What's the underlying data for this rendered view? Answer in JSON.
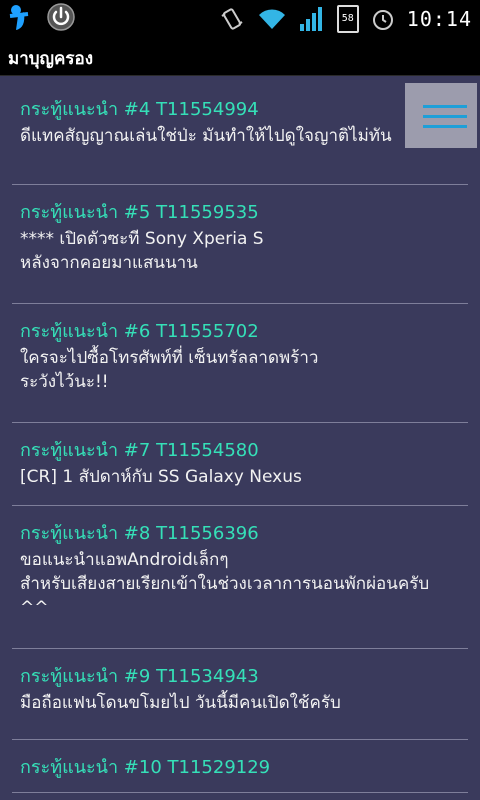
{
  "status_bar": {
    "battery_level": "58",
    "time": "10:14",
    "icons": [
      "carrier-logo-icon",
      "power-icon",
      "vibrate-icon",
      "wifi-icon",
      "signal-icon",
      "battery-icon",
      "alarm-icon"
    ]
  },
  "app_bar": {
    "title": "มาบุญครอง"
  },
  "menu_button": {
    "icon": "hamburger-menu-icon"
  },
  "colors": {
    "background": "#3a3a5c",
    "heading": "#35e0b8",
    "text": "#f2f2f2",
    "divider": "#7e7e9a",
    "menu_accent": "#1e9fd8"
  },
  "threads": [
    {
      "heading": "กระทู้แนะนำ #4 T11554994",
      "body": "ดีแทคสัญญาณเล่นใช่ป่ะ มันทำให้ไปดูใจญาติไม่ทัน"
    },
    {
      "heading": "กระทู้แนะนำ #5 T11559535",
      "body": "**** เปิดตัวซะที Sony Xperia S\nหลังจากคอยมาแสนนาน"
    },
    {
      "heading": "กระทู้แนะนำ #6 T11555702",
      "body": "ใครจะไปซื้อโทรศัพท์ที่ เซ็นทรัลลาดพร้าว\nระวังไว้นะ!!"
    },
    {
      "heading": "กระทู้แนะนำ #7 T11554580",
      "body": "[CR] 1 สัปดาห์กับ SS Galaxy Nexus"
    },
    {
      "heading": "กระทู้แนะนำ #8 T11556396",
      "body": "ขอแนะนำแอพAndroidเล็กๆ\nสำหรับเสียงสายเรียกเข้าในช่วงเวลาการนอนพักผ่อนครับ ^^"
    },
    {
      "heading": "กระทู้แนะนำ #9 T11534943",
      "body": "มือถือแฟนโดนขโมยไป วันนี้มีคนเปิดใช้ครับ"
    },
    {
      "heading": "กระทู้แนะนำ #10 T11529129",
      "body": ""
    }
  ]
}
